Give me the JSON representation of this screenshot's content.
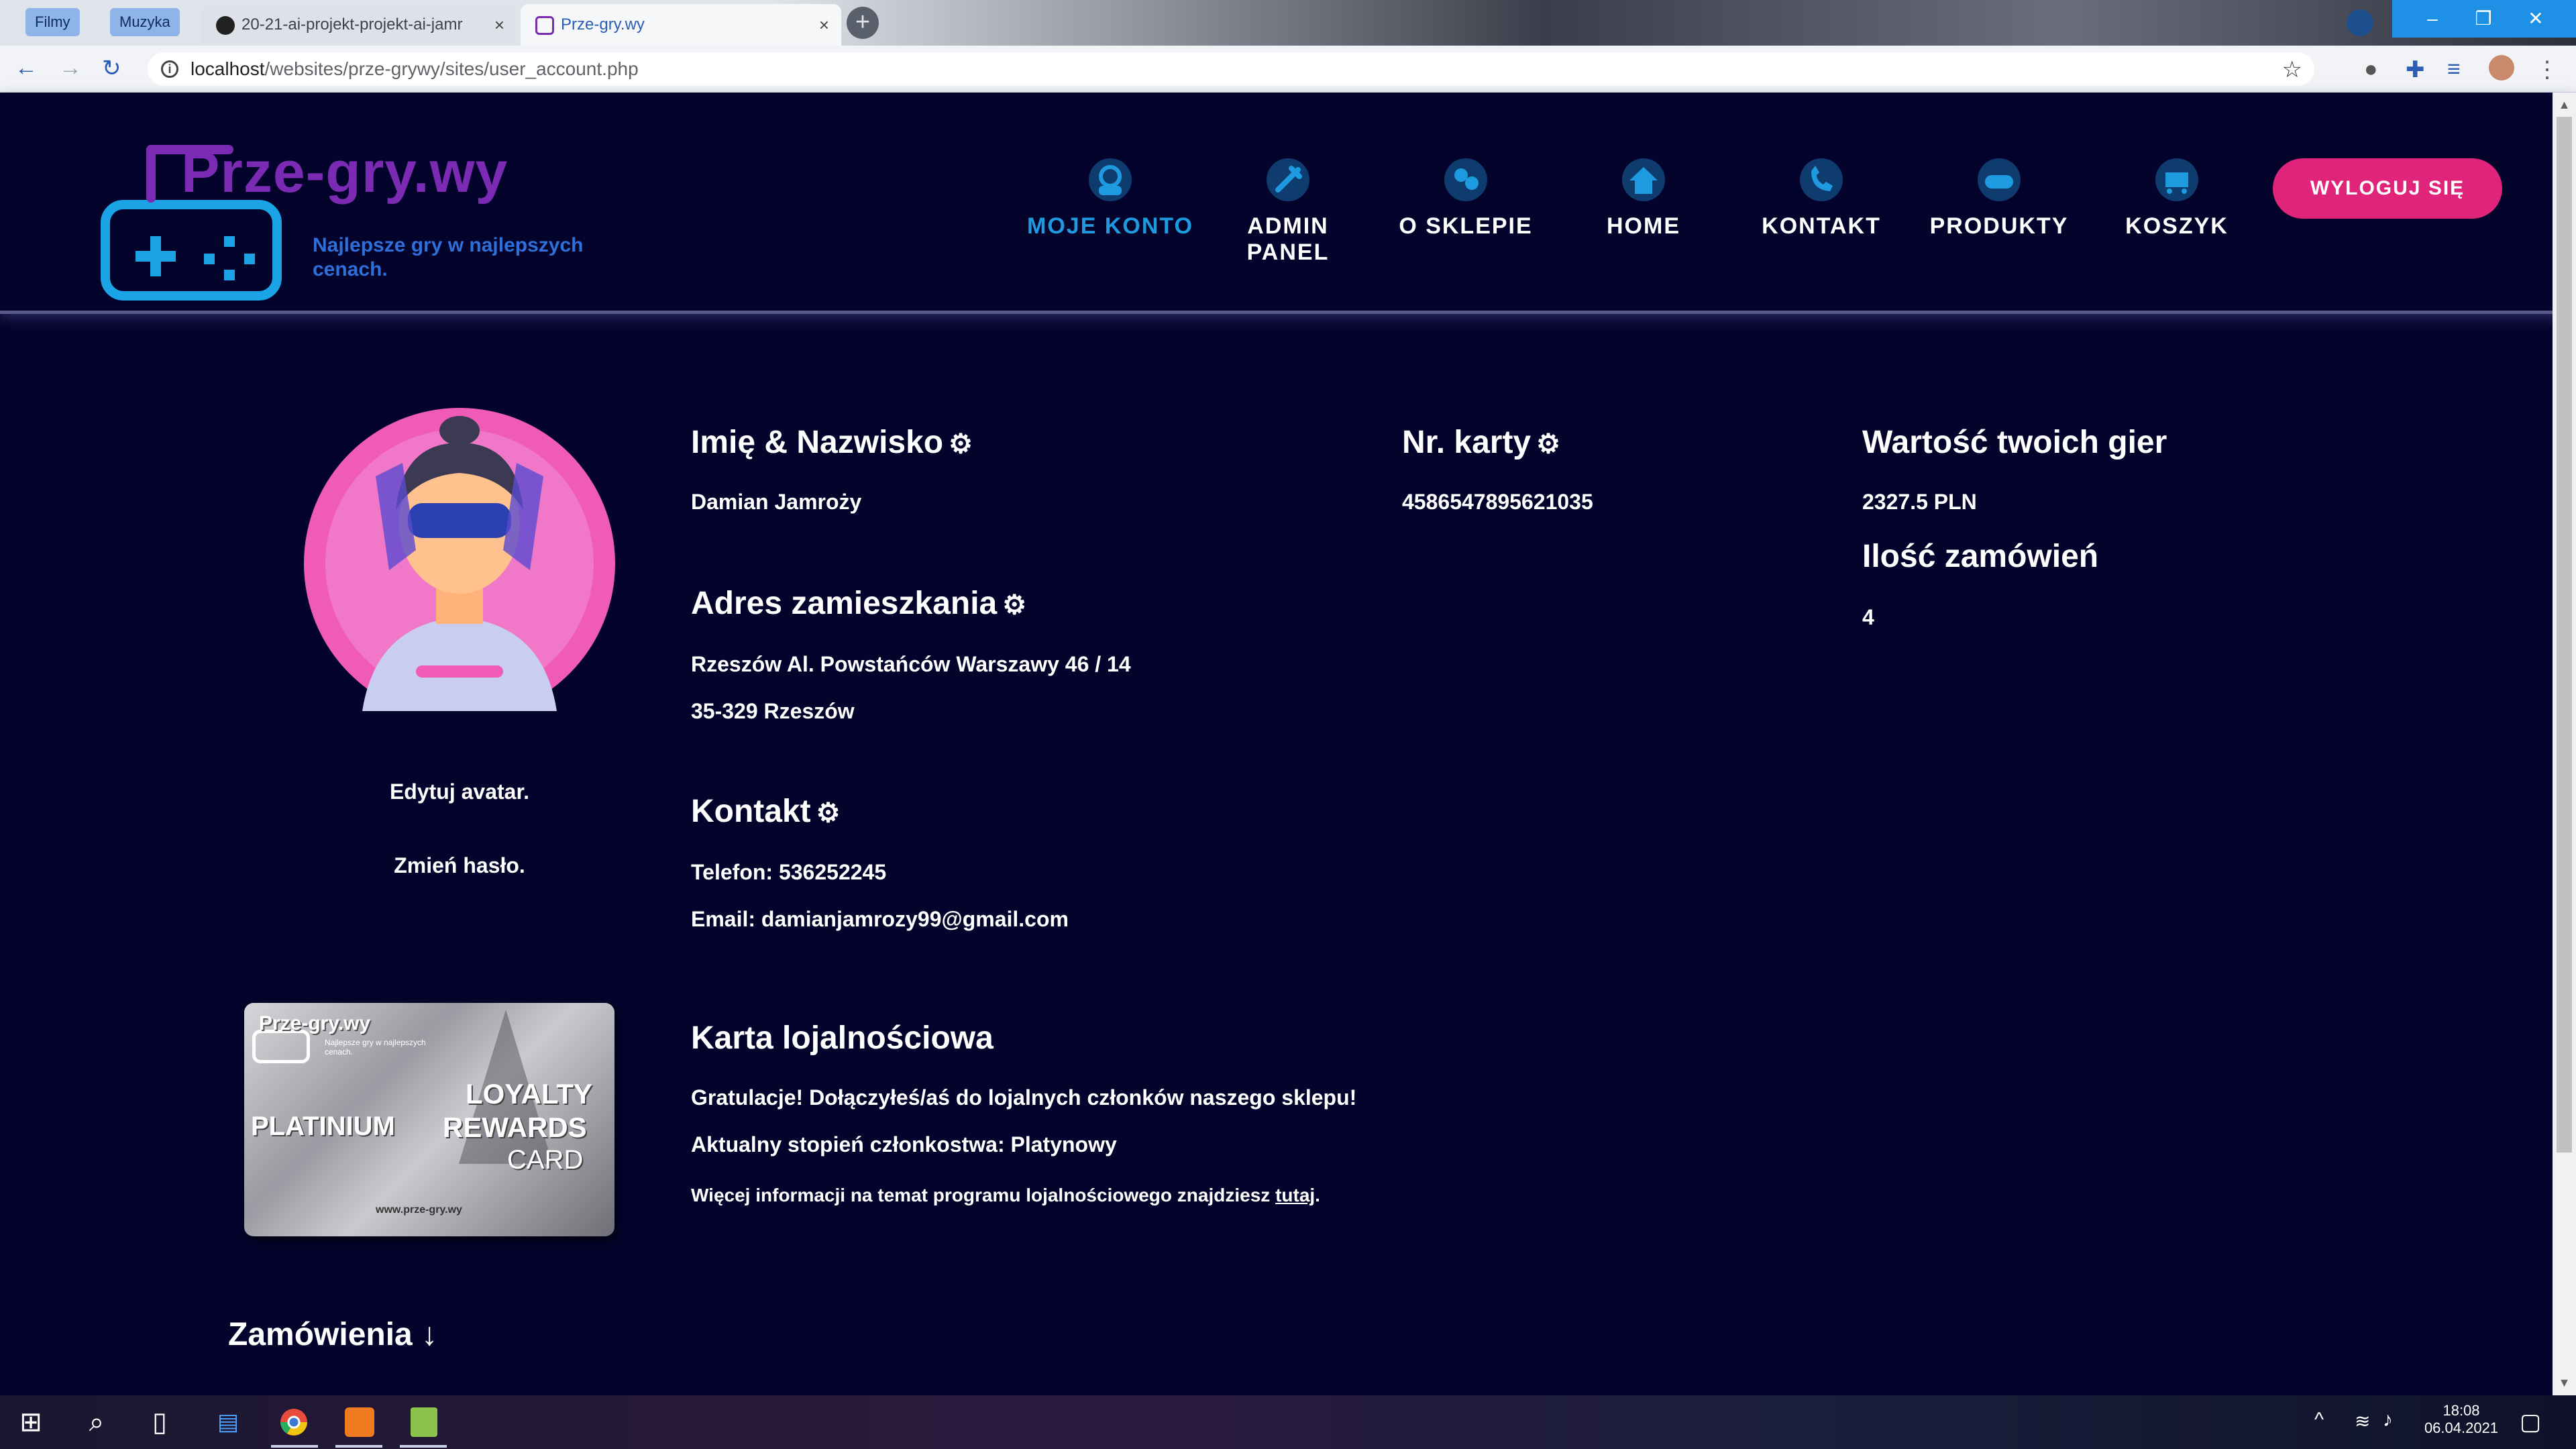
{
  "browser": {
    "bookmarks": [
      "Filmy",
      "Muzyka"
    ],
    "tabs": [
      {
        "title": "20-21-ai-projekt-projekt-ai-jamr",
        "active": false
      },
      {
        "title": "Prze-gry.wy",
        "active": true
      }
    ],
    "url_host": "localhost",
    "url_path": "/websites/prze-grywy/sites/user_account.php",
    "new_tab_symbol": "+",
    "close_symbol": "×",
    "window_controls": [
      "–",
      "❐",
      "✕"
    ]
  },
  "site": {
    "logo_title": "Prze-gry.wy",
    "logo_subtitle": "Najlepsze gry w najlepszych cenach.",
    "nav": [
      {
        "label": "MOJE KONTO",
        "icon": "account-icon",
        "current": true
      },
      {
        "label": "ADMIN PANEL",
        "icon": "admin-icon",
        "current": false
      },
      {
        "label": "O SKLEPIE",
        "icon": "about-icon",
        "current": false
      },
      {
        "label": "HOME",
        "icon": "home-icon",
        "current": false
      },
      {
        "label": "KONTAKT",
        "icon": "phone-icon",
        "current": false
      },
      {
        "label": "PRODUKTY",
        "icon": "gamepad-icon",
        "current": false
      },
      {
        "label": "KOSZYK",
        "icon": "cart-icon",
        "current": false
      }
    ],
    "logout_label": "WYLOGUJ SIĘ",
    "accent_color": "#1e9be0",
    "logout_color": "#e0247a"
  },
  "account": {
    "edit_avatar": "Edytuj avatar.",
    "change_password": "Zmień hasło.",
    "name_heading": "Imię & Nazwisko",
    "name_value": "Damian Jamroży",
    "address_heading": "Adres zamieszkania",
    "address_line1": "Rzeszów Al. Powstańców Warszawy 46 / 14",
    "address_line2": "35-329 Rzeszów",
    "contact_heading": "Kontakt",
    "phone": "Telefon: 536252245",
    "email": "Email: damianjamrozy99@gmail.com",
    "card_heading": "Nr. karty",
    "card_number": "4586547895621035",
    "games_value_heading": "Wartość twoich gier",
    "games_value": "2327.5 PLN",
    "orders_count_heading": "Ilość zamówień",
    "orders_count": "4",
    "gear_symbol": "⚙",
    "loyalty_heading": "Karta lojalnościowa",
    "loyalty_congrats": "Gratulacje! Dołączyłeś/aś do lojalnych członków naszego sklepu!",
    "loyalty_level": "Aktualny stopień członkostwa: Platynowy",
    "loyalty_more_prefix": "Więcej informacji na temat programu lojalnościowego znajdziesz ",
    "loyalty_more_link": "tutaj",
    "loyalty_more_suffix": ".",
    "orders_heading": "Zamówienia ↓"
  },
  "loyalty_card": {
    "logo": "Prze-gry.wy",
    "logo_sub": "Najlepsze gry w najlepszych cenach.",
    "tier": "PLATINIUM",
    "line1": "LOYALTY",
    "line2": "REWARDS",
    "line3": "CARD",
    "url": "www.prze-gry.wy"
  },
  "taskbar": {
    "time": "18:08",
    "date": "06.04.2021"
  }
}
